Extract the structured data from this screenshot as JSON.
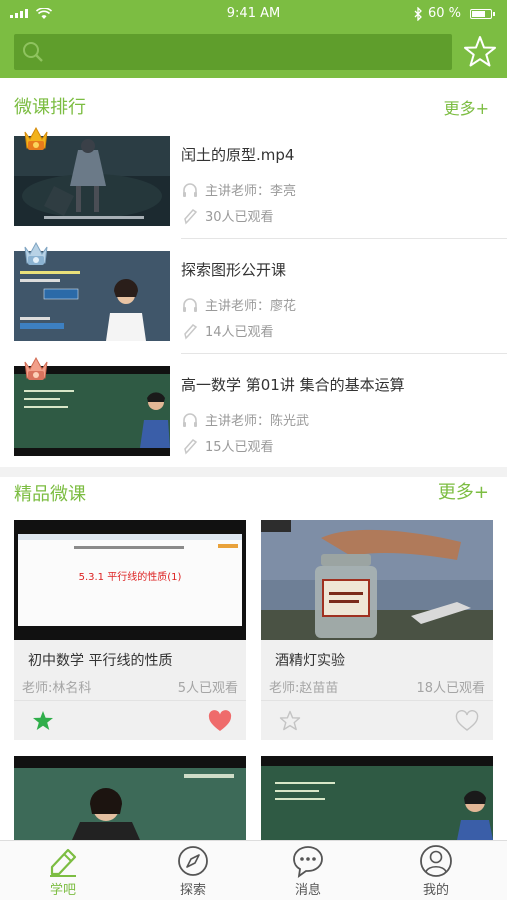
{
  "status_bar": {
    "time": "9:41 AM",
    "battery": "60 %"
  },
  "header": {
    "search_placeholder": ""
  },
  "ranking": {
    "title": "微课排行",
    "more": "更多+",
    "items": [
      {
        "title": "闰土的原型.mp4",
        "teacher": "主讲老师：李亮",
        "views": "30人已观看",
        "crown": "gold"
      },
      {
        "title": "探索图形公开课",
        "teacher": "主讲老师：廖花",
        "views": "14人已观看",
        "crown": "silver"
      },
      {
        "title": "高一数学  第01讲   集合的基本运算",
        "teacher": "主讲老师：陈光武",
        "views": "15人已观看",
        "crown": "bronze"
      }
    ]
  },
  "featured": {
    "title": "精品微课",
    "more": "更多+",
    "cards": [
      {
        "title": "初中数学 平行线的性质",
        "teacher": "老师:林名科",
        "views": "5人已观看",
        "favorited": true,
        "liked": true,
        "thumb_caption": "5.3.1 平行线的性质(1)"
      },
      {
        "title": "酒精灯实验",
        "teacher": "老师:赵苗苗",
        "views": "18人已观看",
        "favorited": false,
        "liked": false,
        "thumb_caption": ""
      }
    ]
  },
  "tabbar": {
    "tabs": [
      {
        "label": "学吧",
        "icon": "pencil-icon",
        "active": true
      },
      {
        "label": "探索",
        "icon": "compass-icon",
        "active": false
      },
      {
        "label": "消息",
        "icon": "chat-bubble-icon",
        "active": false
      },
      {
        "label": "我的",
        "icon": "user-icon",
        "active": false
      }
    ]
  },
  "colors": {
    "accent": "#7cbd42",
    "search_bg": "#5f9e2c",
    "heart": "#ef6b6b",
    "star": "#2fae4a"
  }
}
